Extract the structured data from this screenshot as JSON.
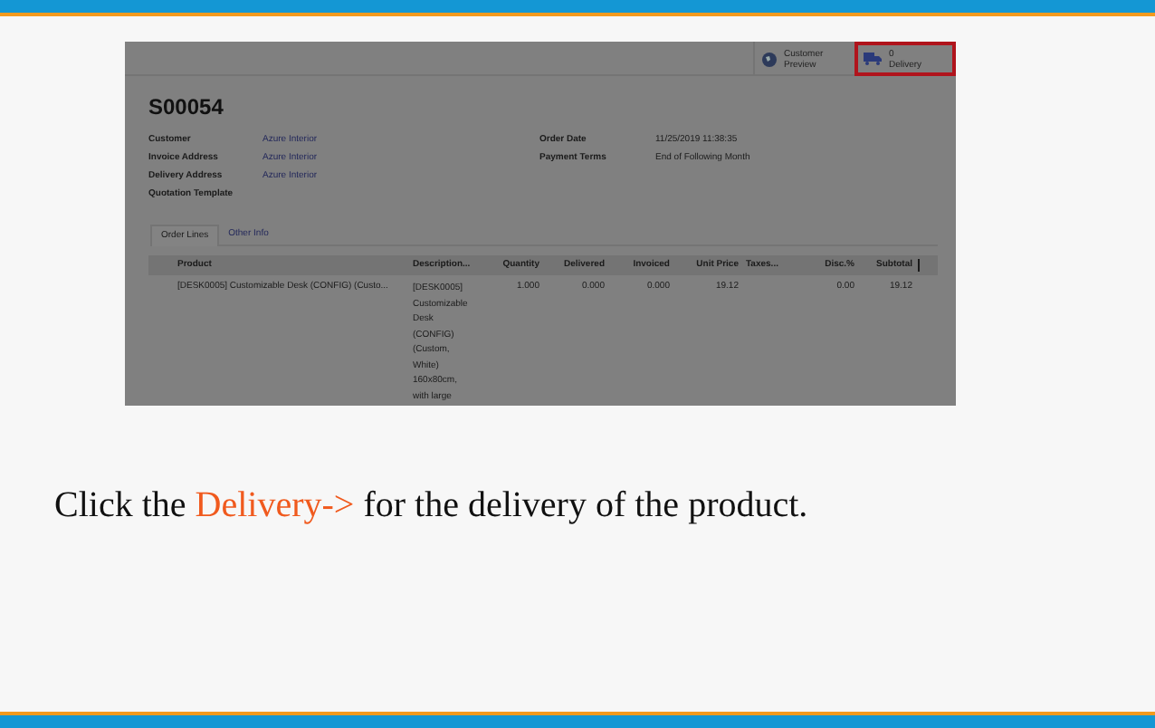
{
  "screenshot": {
    "actions": [
      {
        "kind": "preview",
        "label": "Customer Preview",
        "highlighted": false
      },
      {
        "kind": "delivery",
        "count": "0",
        "label": "Delivery",
        "highlighted": true
      }
    ],
    "title": "S00054",
    "left_fields": [
      {
        "label": "Customer",
        "value": "Azure Interior"
      },
      {
        "label": "Invoice Address",
        "value": "Azure Interior"
      },
      {
        "label": "Delivery Address",
        "value": "Azure Interior"
      },
      {
        "label": "Quotation Template"
      }
    ],
    "right_fields": [
      {
        "label": "Order Date",
        "value": "11/25/2019 11:38:35"
      },
      {
        "label": "Payment Terms",
        "value": "End of Following Month"
      }
    ],
    "tabs": [
      {
        "label": "Order Lines",
        "selected": true
      },
      {
        "label": "Other Info",
        "selected": false
      }
    ],
    "table": {
      "columns": [
        "Product",
        "Description...",
        "Quantity",
        "Delivered",
        "Invoiced",
        "Unit Price",
        "Taxes...",
        "Disc.%",
        "Subtotal"
      ],
      "rows": [
        {
          "product": "[DESK0005] Customizable Desk (CONFIG) (Custo...",
          "description": [
            "[DESK0005]",
            "Customizable",
            "Desk",
            "(CONFIG)",
            "(Custom,",
            "White)",
            "160x80cm,",
            "with large"
          ],
          "quantity": "1.000",
          "delivered": "0.000",
          "invoiced": "0.000",
          "unit_price": "19.12",
          "disc": "0.00",
          "subtotal": "19.12"
        }
      ]
    }
  },
  "caption": {
    "before": "Click the",
    "link": "Delivery->",
    "after": "for the delivery of the product."
  }
}
